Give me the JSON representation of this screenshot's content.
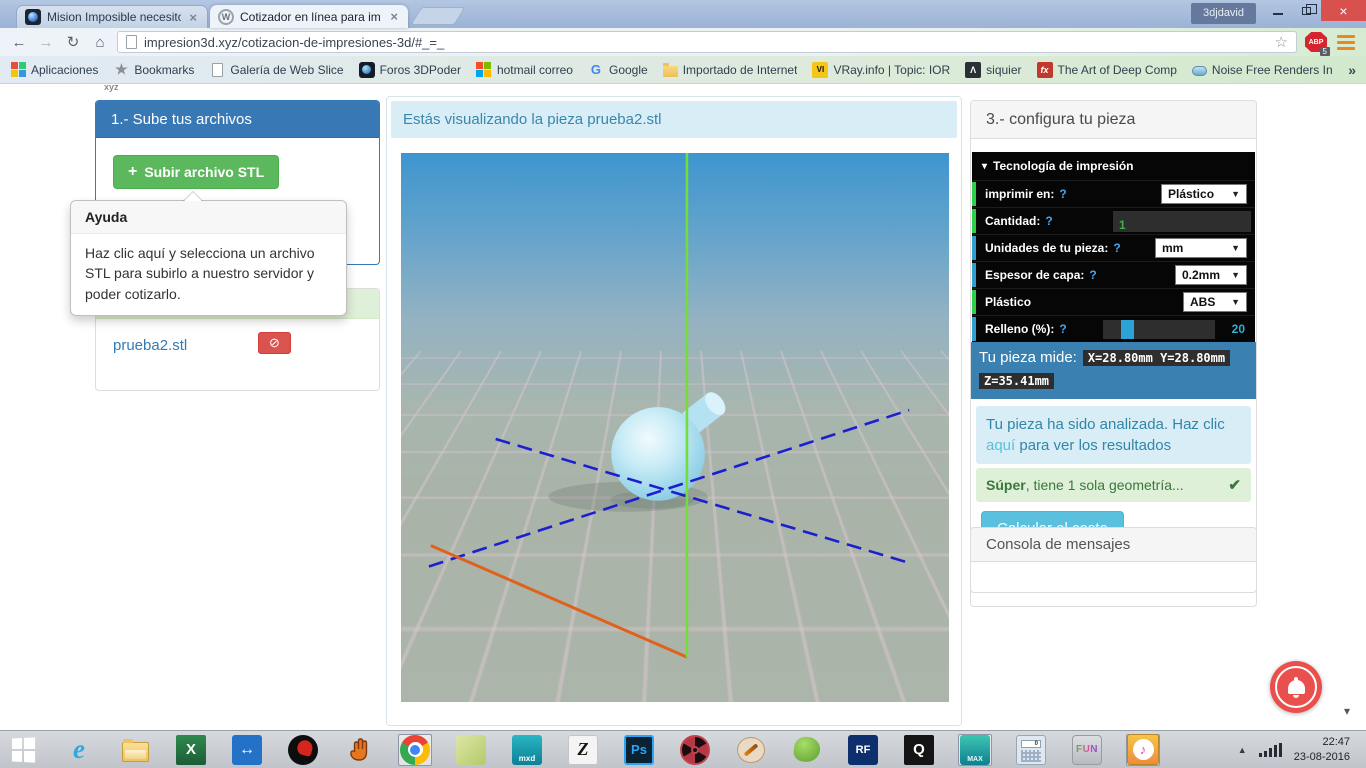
{
  "browser": {
    "tabs": [
      {
        "title": "Mision Imposible necesito",
        "close": "×"
      },
      {
        "title": "Cotizador en línea para im",
        "close": "×",
        "favicon_glyph": "W"
      }
    ],
    "profile": "3djdavid",
    "nav": {
      "back": "←",
      "forward": "→",
      "reload": "↻",
      "home": "⌂",
      "star": "☆"
    },
    "url": "impresion3d.xyz/cotizacion-de-impresiones-3d/#_=_",
    "adblock": {
      "label": "ABP",
      "badge": "5"
    },
    "overflow": "»",
    "bookmarks": [
      {
        "label": "Aplicaciones"
      },
      {
        "label": "Bookmarks",
        "glyph": "★"
      },
      {
        "label": "Galería de Web Slice"
      },
      {
        "label": "Foros 3DPoder"
      },
      {
        "label": "hotmail correo"
      },
      {
        "label": "Google",
        "glyph": "G"
      },
      {
        "label": "Importado de Internet"
      },
      {
        "label": "VRay.info | Topic: IOR",
        "glyph": "VI"
      },
      {
        "label": "siquier",
        "glyph": "Λ"
      },
      {
        "label": "The Art of Deep Comp",
        "glyph": "fx"
      },
      {
        "label": "Noise Free Renders In"
      }
    ]
  },
  "page": {
    "logo_fragment": "xyz",
    "upload": {
      "title": "1.- Sube tus archivos",
      "button_icon": "+",
      "button_label": "Subir archivo STL"
    },
    "tooltip": {
      "title": "Ayuda",
      "body": "Haz clic aquí y selecciona un archivo STL para subirlo a nuestro servidor y poder cotizarlo."
    },
    "files": {
      "name": "prueba2.stl",
      "delete_icon": "⊘"
    },
    "viewer_title": "Estás visualizando la pieza prueba2.stl",
    "config": {
      "title": "3.- configura tu pieza",
      "section_caret": "▾",
      "section": "Tecnología de impresión",
      "select_caret": "▼",
      "rows": [
        {
          "label": "imprimir en:",
          "help": "?",
          "value": "Plástico"
        },
        {
          "label": "Cantidad:",
          "help": "?",
          "value": "1"
        },
        {
          "label": "Unidades de tu pieza:",
          "help": "?",
          "value": "mm"
        },
        {
          "label": "Espesor de capa:",
          "help": "?",
          "value": "0.2mm"
        },
        {
          "label": "Plástico",
          "help": "",
          "value": "ABS"
        },
        {
          "label": "Relleno (%):",
          "help": "?",
          "value": "20"
        }
      ],
      "measures": {
        "label": "Tu pieza mide:",
        "xy": "X=28.80mm Y=28.80mm",
        "z": "Z=35.41mm"
      },
      "analyzed": {
        "pre": "Tu pieza ha sido analizada. Haz clic ",
        "link": "aquí",
        "post": " para ver los resultados"
      },
      "success": {
        "bold": "Súper",
        "rest": ", tiene 1 sola geometría...",
        "check": "✔"
      },
      "calc_button": "Calcular el costo",
      "console_title": "Consola de mensajes"
    }
  },
  "taskbar": {
    "icons": {
      "ie": "e",
      "excel": "X",
      "teamviewer": "↔",
      "mixamo": "mxd",
      "zbrush": "Z",
      "photoshop": "Ps",
      "realflow": "RF",
      "quixel": "Q",
      "max": "MAX",
      "calc_screen": "0",
      "fun": "FUN",
      "itunes": "♪"
    },
    "tray": {
      "arrow": "▲",
      "time": "22:47",
      "date": "23-08-2016"
    }
  }
}
